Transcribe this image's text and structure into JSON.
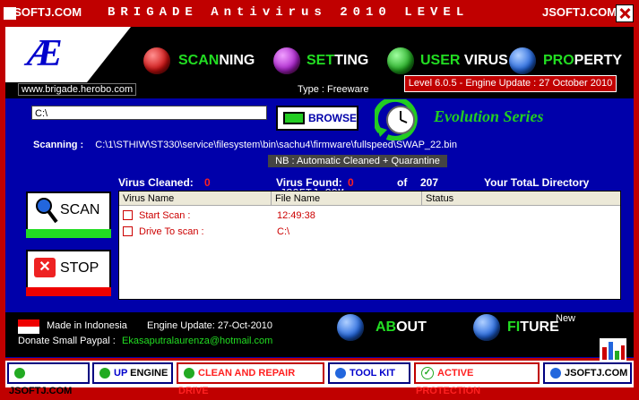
{
  "window": {
    "title": "BRIGADE  Antivirus  2010  LEVEL",
    "overlay_left": "JSOFTJ.COM",
    "overlay_right": "JSOFTJ.COM"
  },
  "header": {
    "logo": "Æ",
    "nav": [
      {
        "green": "SCAN",
        "white": "NING",
        "orb": "#cc1111"
      },
      {
        "green": "SET",
        "white": "TING",
        "orb": "#aa22cc"
      },
      {
        "green": "USER ",
        "white": "VIRUS",
        "orb": "#22aa22"
      },
      {
        "green": "PRO",
        "white": "PERTY",
        "orb": "#2266dd"
      }
    ],
    "url": "www.brigade.herobo.com",
    "type": "Type  : Freeware",
    "level": "Level 6.0.5   - Engine Update : 27 October 2010"
  },
  "scan_panel": {
    "path_value": "C:\\",
    "browse_label": "BROWSE",
    "series": "Evolution Series",
    "scanning_label": "Scanning :",
    "scanning_path": "C:\\1\\STHIW\\ST330\\service\\filesystem\\bin\\sachu4\\firmware\\fullspeed\\SWAP_22.bin",
    "nb": "NB :    Automatic Cleaned + Quarantine"
  },
  "stats": {
    "cleaned_label": "Virus Cleaned:",
    "cleaned_value": "0",
    "found_label": "Virus Found:",
    "found_value": "0",
    "of": "of",
    "total": "207",
    "directory": "Your TotaL Directory"
  },
  "watermark": "JSOFTJ.COM",
  "grid": {
    "columns": [
      "Virus Name",
      "File Name",
      "Status"
    ],
    "rows": [
      {
        "name": "Start Scan :",
        "file": "12:49:38",
        "status": ""
      },
      {
        "name": "Drive To scan :",
        "file": "C:\\",
        "status": ""
      }
    ]
  },
  "buttons": {
    "scan": "SCAN",
    "stop": "STOP"
  },
  "footer": {
    "made_in": "Made in Indonesia",
    "engine_update": "Engine Update:  27-Oct-2010",
    "donate": "Donate Small Paypal :",
    "email": "Ekasaputralaurenza@hotmail.com",
    "about_green": "AB",
    "about_white": "OUT",
    "fiture_green": "FI",
    "fiture_white": "TURE",
    "new": "New"
  },
  "toolbar": {
    "items": [
      {
        "label": "JSOFTJ.COM",
        "dot": "#22aa22"
      },
      {
        "label_blue": "UP",
        "label": "ENGINE",
        "dot": "#22aa22"
      },
      {
        "label": "CLEAN AND REPAIR DRIVE",
        "dot": "#22aa22"
      },
      {
        "label": "TOOL KIT",
        "dot": "#2266dd"
      },
      {
        "label": "ACTIVE PROTECTION",
        "dot": "#22aa22"
      },
      {
        "label": "JSOFTJ.COM",
        "dot": "#2266dd"
      }
    ]
  }
}
